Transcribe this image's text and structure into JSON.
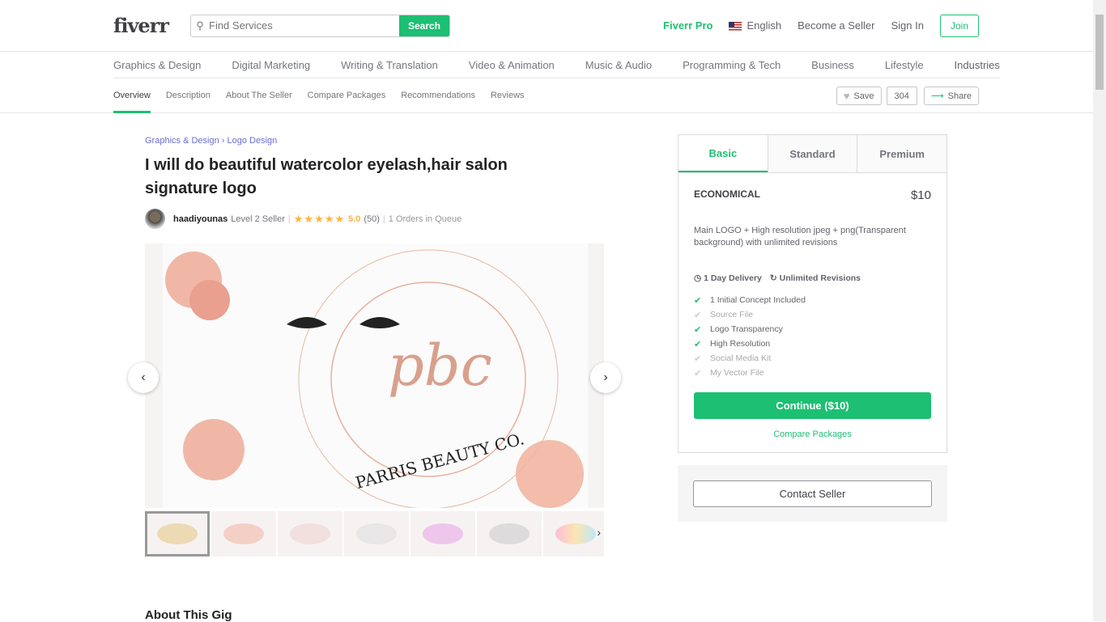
{
  "header": {
    "logo": "fiverr",
    "search_placeholder": "Find Services",
    "search_button": "Search",
    "fiverr_pro": "Fiverr Pro",
    "language": "English",
    "become_seller": "Become a Seller",
    "sign_in": "Sign In",
    "join": "Join"
  },
  "categories": [
    "Graphics & Design",
    "Digital Marketing",
    "Writing & Translation",
    "Video & Animation",
    "Music & Audio",
    "Programming & Tech",
    "Business",
    "Lifestyle",
    "Industries"
  ],
  "subnav": {
    "tabs": [
      "Overview",
      "Description",
      "About The Seller",
      "Compare Packages",
      "Recommendations",
      "Reviews"
    ],
    "save": "Save",
    "save_count": "304",
    "share": "Share"
  },
  "gig": {
    "breadcrumb": [
      "Graphics & Design",
      "Logo Design"
    ],
    "title": "I will do beautiful watercolor eyelash,hair salon signature logo",
    "seller": "haadiyounas",
    "level": "Level 2 Seller",
    "rating": "5.0",
    "stars": 5,
    "reviews": "(50)",
    "queue": "1 Orders in Queue",
    "image_logo_text": "PARRIS BEAUTY CO.",
    "about_heading": "About This Gig"
  },
  "package": {
    "tabs": [
      "Basic",
      "Standard",
      "Premium"
    ],
    "name": "ECONOMICAL",
    "price": "$10",
    "description": "Main LOGO + High resolution jpeg + png(Transparent background) with unlimited revisions",
    "delivery": "1 Day Delivery",
    "revisions": "Unlimited Revisions",
    "features": [
      {
        "label": "1 Initial Concept Included",
        "included": true
      },
      {
        "label": "Source File",
        "included": false
      },
      {
        "label": "Logo Transparency",
        "included": true
      },
      {
        "label": "High Resolution",
        "included": true
      },
      {
        "label": "Social Media Kit",
        "included": false
      },
      {
        "label": "My Vector File",
        "included": false
      }
    ],
    "continue": "Continue ($10)",
    "compare": "Compare Packages",
    "contact": "Contact Seller"
  },
  "colors": {
    "brand": "#1dbf73",
    "star": "#ffb33e"
  }
}
